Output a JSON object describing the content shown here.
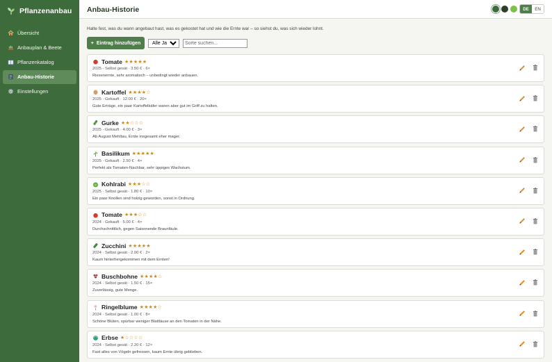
{
  "app": {
    "title": "Pflanzenanbau"
  },
  "sidebar": {
    "items": [
      {
        "label": "Übersicht",
        "icon": "house-icon",
        "active": false
      },
      {
        "label": "Anbauplan & Beete",
        "icon": "garden-bed-icon",
        "active": false
      },
      {
        "label": "Pflanzenkatalog",
        "icon": "book-icon",
        "active": false
      },
      {
        "label": "Anbau-Historie",
        "icon": "history-icon",
        "active": true
      },
      {
        "label": "Einstellungen",
        "icon": "gear-icon",
        "active": false
      }
    ]
  },
  "header": {
    "title": "Anbau-Historie",
    "theme_colors": [
      "#3e6b3c",
      "#2b3f2b",
      "#7cc04a"
    ],
    "lang": {
      "active": "DE",
      "inactive": "EN"
    }
  },
  "main": {
    "intro": "Halte fest, was du wann angebaut hast, was es gekostet hat und wie die Ernte war – so siehst du, was sich wieder lohnt.",
    "add_button": "Eintrag hinzufügen",
    "add_icon": "+",
    "year_filter": "Alle Jahre",
    "search_placeholder": "Sorte suchen..."
  },
  "entries": [
    {
      "name": "Tomate",
      "icon": "tomato-icon",
      "rating": 5,
      "meta": "2025 · Selbst gesät · 3.50 € · 6×",
      "note": "Riesenernte, sehr aromatisch – unbedingt wieder anbauen."
    },
    {
      "name": "Kartoffel",
      "icon": "potato-icon",
      "rating": 4,
      "meta": "2025 · Gekauft · 12.00 € · 20×",
      "note": "Gute Erträge, ein paar Kartoffelkäfer waren aber gut im Griff zu halten."
    },
    {
      "name": "Gurke",
      "icon": "cucumber-icon",
      "rating": 2,
      "meta": "2025 · Gekauft · 4.00 € · 3×",
      "note": "Ab August Mehltau, Ernte insgesamt eher mager."
    },
    {
      "name": "Basilikum",
      "icon": "herb-icon",
      "rating": 5,
      "meta": "2025 · Gekauft · 2.50 € · 4×",
      "note": "Perfekt als Tomaten-Nachbar, sehr üppiges Wachstum."
    },
    {
      "name": "Kohlrabi",
      "icon": "kohlrabi-icon",
      "rating": 3,
      "meta": "2025 · Selbst gesät · 1.80 € · 10×",
      "note": "Ein paar Knollen sind holzig geworden, sonst in Ordnung."
    },
    {
      "name": "Tomate",
      "icon": "tomato-icon",
      "rating": 3,
      "meta": "2024 · Gekauft · 5.00 € · 4×",
      "note": "Durchschnittlich, gegen Saisonende Braunfäule."
    },
    {
      "name": "Zucchini",
      "icon": "zucchini-icon",
      "rating": 5,
      "meta": "2024 · Selbst gesät · 2.00 € · 2×",
      "note": "Kaum hinterhergekommen mit dem Ernten!"
    },
    {
      "name": "Buschbohne",
      "icon": "bean-icon",
      "rating": 4,
      "meta": "2024 · Selbst gesät · 1.50 € · 15×",
      "note": "Zuverlässig, gute Menge."
    },
    {
      "name": "Ringelblume",
      "icon": "flower-icon",
      "rating": 4,
      "meta": "2024 · Selbst gesät · 1.00 € · 8×",
      "note": "Schöne Blüten, spürbar weniger Blattläuse an den Tomaten in der Nähe."
    },
    {
      "name": "Erbse",
      "icon": "pea-icon",
      "rating": 1,
      "meta": "2024 · Selbst gesät · 2.20 € · 12×",
      "note": "Fast alles von Vögeln gefressen, kaum Ernte übrig geblieben."
    }
  ]
}
